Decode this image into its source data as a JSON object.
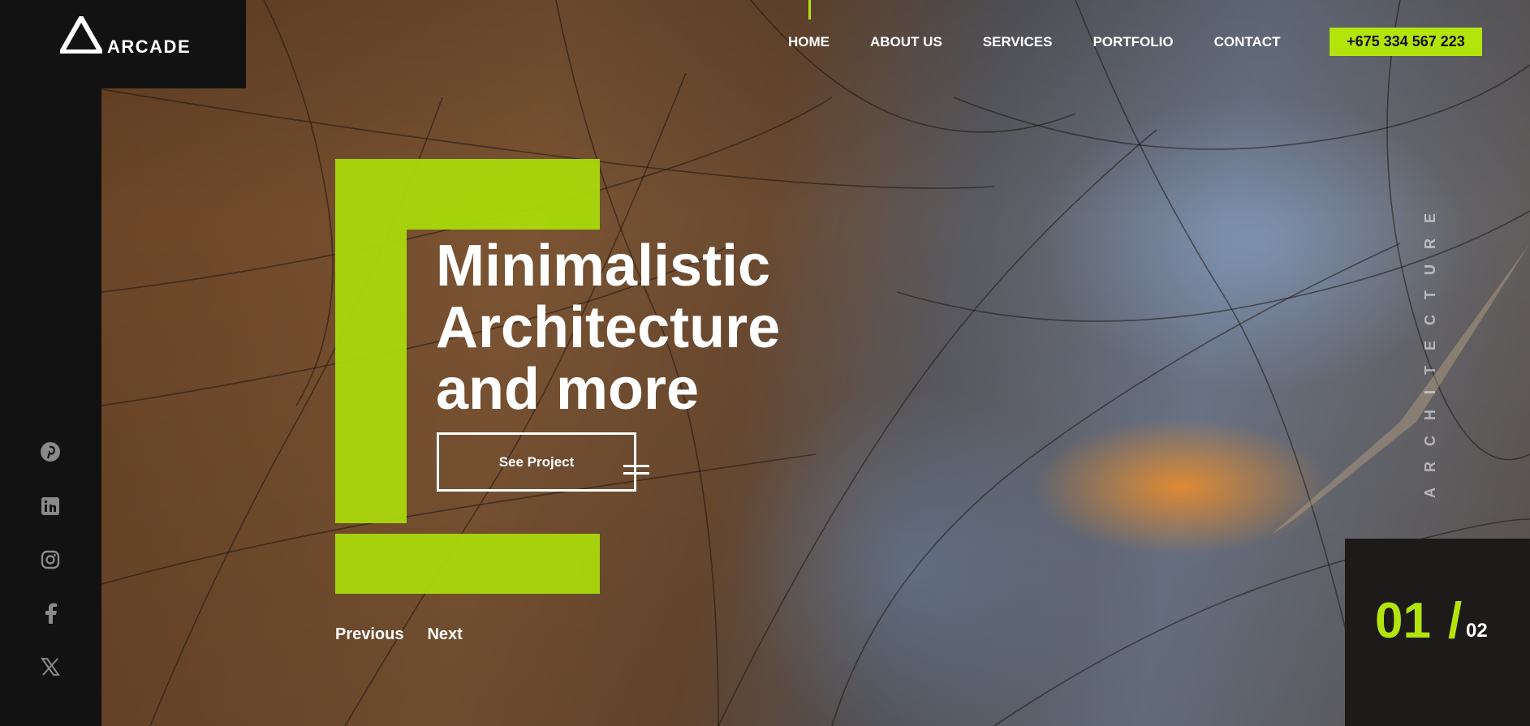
{
  "brand": {
    "name": "ARCADE",
    "accent": "#b3e40c"
  },
  "nav": {
    "items": [
      {
        "label": "HOME",
        "active": true
      },
      {
        "label": "ABOUT US"
      },
      {
        "label": "SERVICES"
      },
      {
        "label": "PORTFOLIO"
      },
      {
        "label": "CONTACT"
      }
    ],
    "phone": "+675 334 567 223"
  },
  "hero": {
    "headline_lines": [
      "Minimalistic",
      "Architecture",
      "and more"
    ],
    "cta_label": "See Project",
    "vertical_label": "ARCHITECTURE"
  },
  "slider": {
    "previous_label": "Previous",
    "next_label": "Next",
    "current": "01 ",
    "separator": "/",
    "total": "02"
  },
  "social": [
    {
      "icon": "pinterest-icon"
    },
    {
      "icon": "linkedin-icon"
    },
    {
      "icon": "instagram-icon"
    },
    {
      "icon": "facebook-icon"
    },
    {
      "icon": "x-twitter-icon"
    }
  ]
}
